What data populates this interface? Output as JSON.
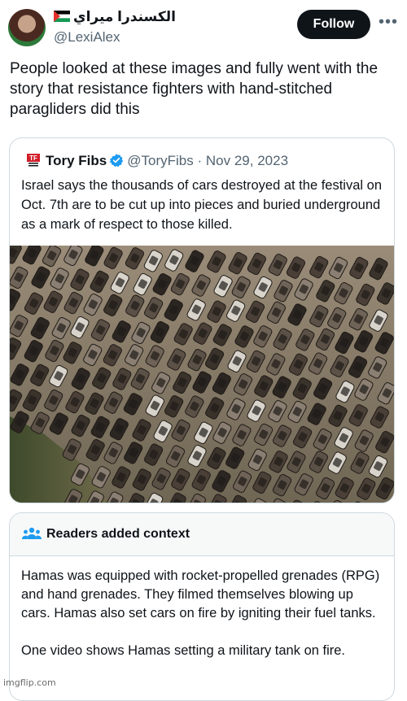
{
  "author": {
    "display_name": "الكسندرا ميراي",
    "handle": "@LexiAlex",
    "flag_icon": "palestine-flag-icon"
  },
  "follow_label": "Follow",
  "more_icon": "more-horizontal-icon",
  "tweet_text": "People looked at these images and fully went with the story that resistance fighters with hand-stitched paragliders did this",
  "quote": {
    "name": "Tory Fibs",
    "handle": "@ToryFibs",
    "separator": "·",
    "date": "Nov 29, 2023",
    "text": "Israel says the thousands of cars destroyed at the festival on Oct. 7th are to be cut up into pieces and buried underground as a mark of respect to those killed.",
    "image_alt": "aerial photo of rows of burned-out cars"
  },
  "context": {
    "title": "Readers added context",
    "paragraph1": "Hamas was equipped with rocket-propelled grenades (RPG) and hand grenades. They filmed themselves blowing up cars. Hamas also set cars on fire by igniting their fuel tanks.",
    "paragraph2": "One video shows Hamas setting a military tank on fire."
  },
  "watermark": "imgflip.com",
  "colors": {
    "text": "#0f1419",
    "muted": "#536471",
    "verified": "#1d9bf0",
    "border": "#cfd9de"
  }
}
